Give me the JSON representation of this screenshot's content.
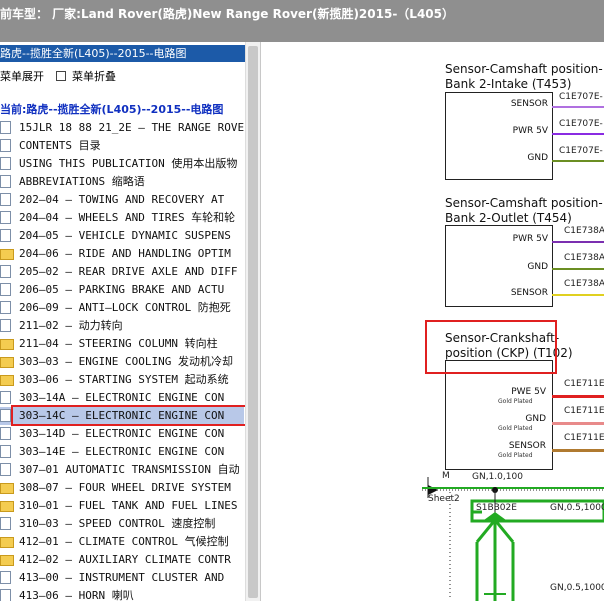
{
  "title": "前车型：  厂家:Land Rover(路虎)New Range Rover(新揽胜)2015-（L405）",
  "left_panel": {
    "header": "路虎--揽胜全新(L405)--2015--电路图",
    "expand_label": "菜单展开",
    "collapse_label": "菜单折叠",
    "current_label": "当前:路虎--揽胜全新(L405)--2015--电路图",
    "items": [
      {
        "label": "15JLR 18 88 21_2E — THE RANGE ROVER",
        "icon": "document-icon"
      },
      {
        "label": "CONTENTS 目录",
        "icon": "document-icon"
      },
      {
        "label": "USING THIS PUBLICATION 使用本出版物",
        "icon": "document-icon"
      },
      {
        "label": "ABBREVIATIONS 缩略语",
        "icon": "document-icon"
      },
      {
        "label": "202—04 — TOWING AND RECOVERY AT",
        "icon": "document-icon"
      },
      {
        "label": "204—04 — WHEELS AND TIRES 车轮和轮",
        "icon": "document-icon"
      },
      {
        "label": "204—05 — VEHICLE DYNAMIC SUSPENS",
        "icon": "document-icon"
      },
      {
        "label": "204—06 — RIDE AND HANDLING OPTIM",
        "icon": "folder-icon"
      },
      {
        "label": "205—02 — REAR DRIVE AXLE AND DIFF",
        "icon": "document-icon"
      },
      {
        "label": "206—05 — PARKING BRAKE AND ACTU",
        "icon": "document-icon"
      },
      {
        "label": "206—09 — ANTI—LOCK CONTROL 防抱死",
        "icon": "document-icon"
      },
      {
        "label": "211—02 — 动力转向",
        "icon": "document-icon"
      },
      {
        "label": "211—04 — STEERING COLUMN 转向柱",
        "icon": "folder-icon"
      },
      {
        "label": "303—03 — ENGINE COOLING 发动机冷却",
        "icon": "folder-icon"
      },
      {
        "label": "303—06 — STARTING SYSTEM 起动系统",
        "icon": "folder-icon"
      },
      {
        "label": "303—14A — ELECTRONIC ENGINE CON",
        "icon": "document-icon"
      },
      {
        "label": "303—14C — ELECTRONIC ENGINE CON",
        "icon": "document-icon",
        "selected": true
      },
      {
        "label": "303—14D — ELECTRONIC ENGINE CON",
        "icon": "document-icon"
      },
      {
        "label": "303—14E — ELECTRONIC ENGINE CON",
        "icon": "document-icon"
      },
      {
        "label": "307—01 AUTOMATIC TRANSMISSION 自动",
        "icon": "document-icon"
      },
      {
        "label": "308—07 — FOUR WHEEL DRIVE SYSTEM",
        "icon": "folder-icon"
      },
      {
        "label": "310—01 — FUEL TANK AND FUEL LINES",
        "icon": "folder-icon"
      },
      {
        "label": "310—03 — SPEED CONTROL 速度控制",
        "icon": "document-icon"
      },
      {
        "label": "412—01 — CLIMATE CONTROL 气候控制",
        "icon": "folder-icon"
      },
      {
        "label": "412—02 — AUXILIARY CLIMATE CONTR",
        "icon": "folder-icon"
      },
      {
        "label": "413—00 — INSTRUMENT CLUSTER AND",
        "icon": "document-icon"
      },
      {
        "label": "413—06 — HORN 喇叭",
        "icon": "document-icon"
      }
    ]
  },
  "diagram": {
    "sensors": [
      {
        "title": "Sensor-Camshaft position-\nBank 2-Intake (T453)",
        "line1": "Sensor-Camshaft position-",
        "line2": "Bank 2-Intake (T453)",
        "pins": [
          {
            "label": "SENSOR",
            "conn": "C1E707E-",
            "color": "#b070e0"
          },
          {
            "label": "PWR 5V",
            "conn": "C1E707E-",
            "color": "#8a2be2"
          },
          {
            "label": "GND",
            "conn": "C1E707E-",
            "color": "#6b8e23"
          }
        ]
      },
      {
        "line1": "Sensor-Camshaft position-",
        "line2": "Bank 2-Outlet (T454)",
        "pins": [
          {
            "label": "PWR 5V",
            "conn": "C1E738A",
            "color": "#7b2fb0"
          },
          {
            "label": "GND",
            "conn": "C1E738A",
            "color": "#6b8e23"
          },
          {
            "label": "SENSOR",
            "conn": "C1E738A",
            "color": "#e0d020"
          }
        ]
      },
      {
        "line1": "Sensor-Crankshaft-",
        "line2": "position (CKP) (T102)",
        "pins": [
          {
            "label": "PWE 5V",
            "sub": "Gold Plated",
            "conn": "C1E711E",
            "color": "#e02020"
          },
          {
            "label": "GND",
            "sub": "Gold Plated",
            "conn": "C1E711E",
            "color": "#e88a8a"
          },
          {
            "label": "SENSOR",
            "sub": "Gold Plated",
            "conn": "C1E711E",
            "color": "#b07a30"
          }
        ]
      }
    ],
    "ground_label": "M",
    "ground_wire": "GN,1.0,100",
    "sheet_label": "Sheet2",
    "splice_label": "S1BB02E",
    "splice_wire": "GN,0.5,1000",
    "bottom_wire": "GN,0.5,1000",
    "wire_green": "#22aa22",
    "accent_red": "#e02020"
  }
}
